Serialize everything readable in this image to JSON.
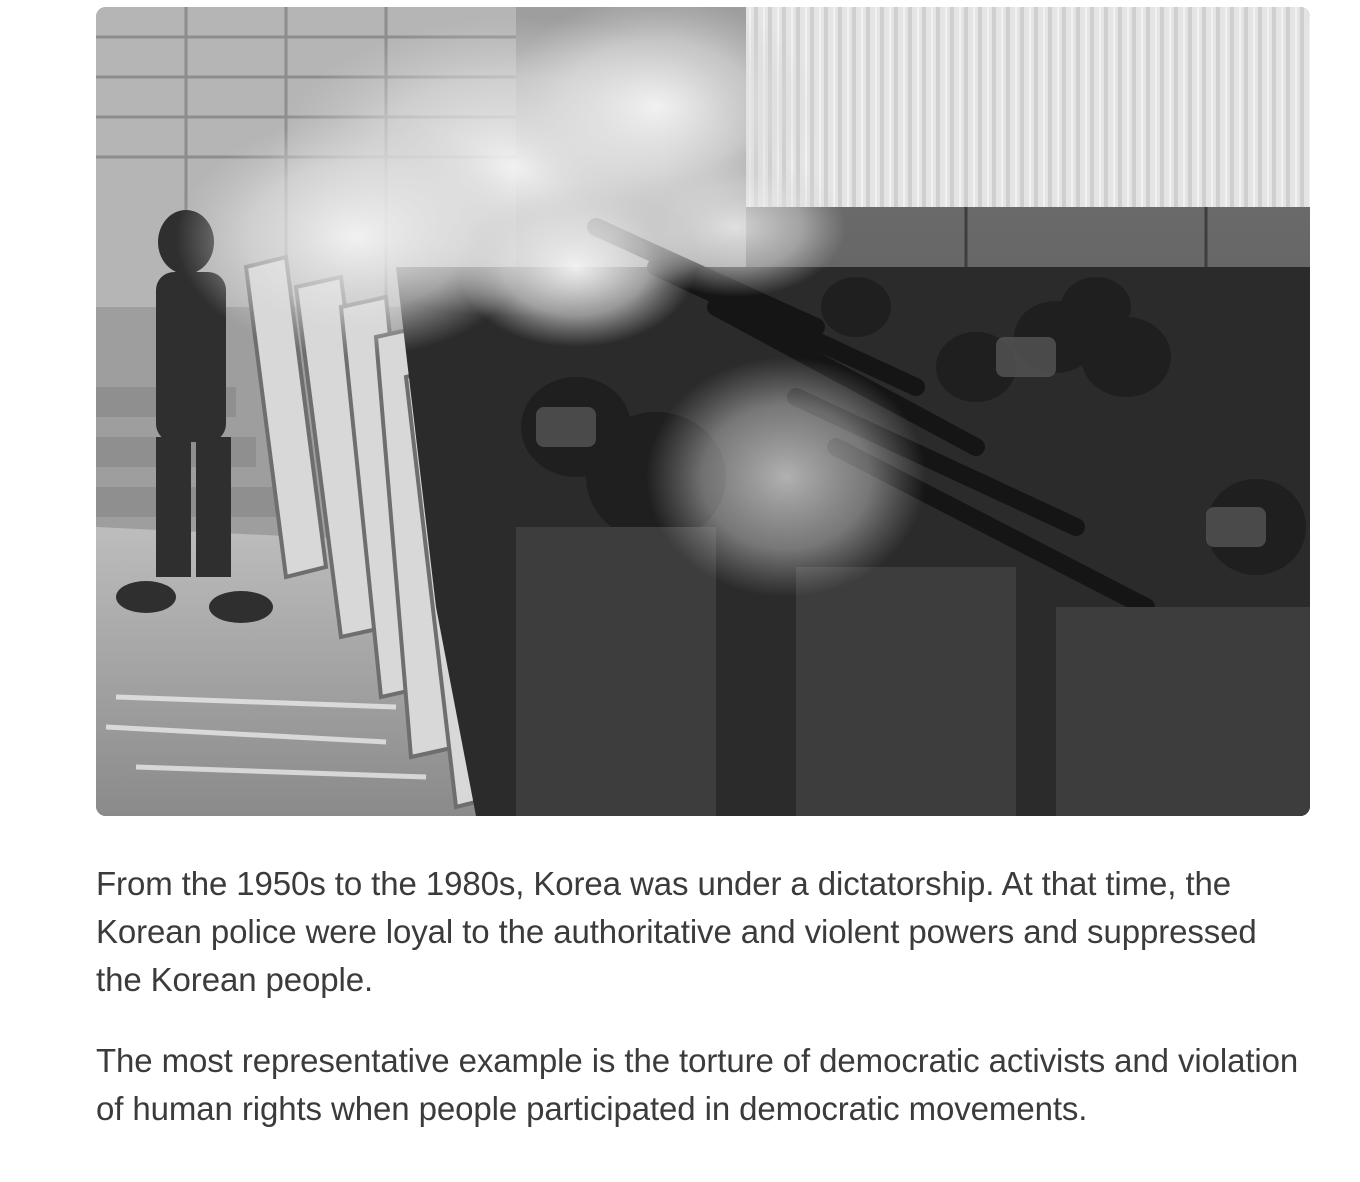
{
  "article": {
    "image": {
      "icon": "photo-riot-police-tear-gas"
    },
    "paragraphs": [
      "From the 1950s to the 1980s, Korea was under a dictatorship. At that time, the Korean police were loyal to the authoritative and violent powers and suppressed the Korean people.",
      "The most representative example is the torture of democratic activists and violation of human rights when people participated in democratic movements."
    ]
  }
}
